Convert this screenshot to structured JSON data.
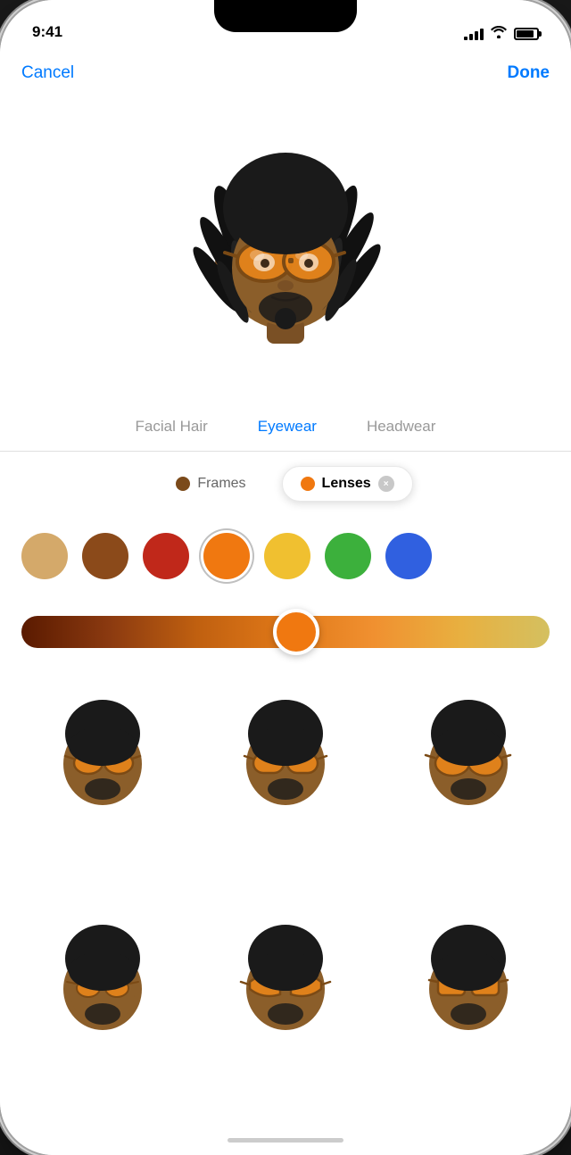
{
  "statusBar": {
    "time": "9:41",
    "greenDot": true
  },
  "nav": {
    "cancelLabel": "Cancel",
    "doneLabel": "Done"
  },
  "categoryTabs": [
    {
      "id": "facial-hair",
      "label": "Facial Hair",
      "active": false
    },
    {
      "id": "eyewear",
      "label": "Eyewear",
      "active": true
    },
    {
      "id": "headwear",
      "label": "Headwear",
      "active": false
    }
  ],
  "filters": [
    {
      "id": "frames",
      "label": "Frames",
      "active": false,
      "dotColor": "#7B4A1A"
    },
    {
      "id": "lenses",
      "label": "Lenses",
      "active": true,
      "dotColor": "#F07810",
      "hasClose": true
    }
  ],
  "colorSwatches": [
    {
      "id": "beige",
      "color": "#D4A96A",
      "selected": false
    },
    {
      "id": "brown",
      "color": "#8B4A1A",
      "selected": false
    },
    {
      "id": "red",
      "color": "#C0281A",
      "selected": false
    },
    {
      "id": "orange",
      "color": "#F07810",
      "selected": true
    },
    {
      "id": "yellow",
      "color": "#F0C030",
      "selected": false
    },
    {
      "id": "green",
      "color": "#3CB03C",
      "selected": false
    },
    {
      "id": "blue",
      "color": "#3060E0",
      "selected": false
    }
  ],
  "slider": {
    "value": 52,
    "gradientStart": "#8B3A00",
    "gradientEnd": "#F0A840"
  },
  "memojiGrid": [
    {
      "id": "m1",
      "style": "round-glasses-orange"
    },
    {
      "id": "m2",
      "style": "wide-glasses-orange"
    },
    {
      "id": "m3",
      "style": "large-glasses-orange"
    },
    {
      "id": "m4",
      "style": "round-small-glasses"
    },
    {
      "id": "m5",
      "style": "aviator-glasses"
    },
    {
      "id": "m6",
      "style": "square-glasses"
    }
  ],
  "icons": {
    "close": "×"
  }
}
